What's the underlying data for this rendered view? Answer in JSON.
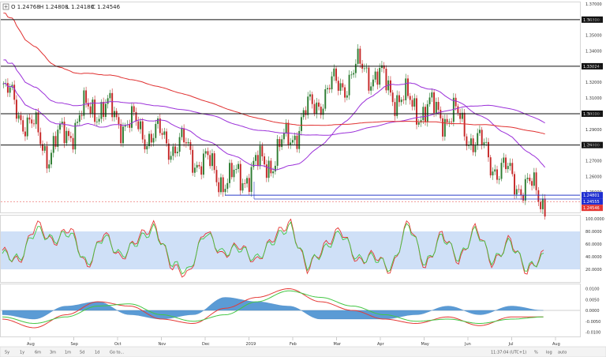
{
  "ohlc_header": {
    "open": "O 1.24768",
    "high": "H 1.24808",
    "low": "L 1.24180",
    "close": "C 1.24546"
  },
  "colors": {
    "candle_up": "#2e7d32",
    "candle_down": "#c62828",
    "hline": "#111111",
    "support": "#2a3cc9",
    "ma_purple": "#9b30d9",
    "ma_red": "#e03030",
    "rsi_band": "#cfe0f7",
    "osc_red": "#e53935",
    "osc_green": "#43c643",
    "macd_hist": "#5b9bd5",
    "price_tag_blue": "#1f2fd1",
    "price_tag_red": "#e53935"
  },
  "toolbar": {
    "left": [
      "5y",
      "1y",
      "6m",
      "3m",
      "1m",
      "5d",
      "1d",
      "Go to..."
    ],
    "time": "11:37:04 (UTC+1)",
    "right": [
      "%",
      "log",
      "auto"
    ]
  },
  "chart_data": [
    {
      "type": "candlestick",
      "instrument_panel": "price",
      "x_tick_labels": [
        "Aug",
        "Sep",
        "Oct",
        "Nov",
        "Dec",
        "2019",
        "Feb",
        "Mar",
        "Apr",
        "May",
        "Jun",
        "Jul",
        "Aug"
      ],
      "y_tick_labels": [
        "1.37000",
        "1.36000",
        "1.35000",
        "1.34000",
        "1.33000",
        "1.32000",
        "1.31000",
        "1.30000",
        "1.29000",
        "1.28000",
        "1.27000",
        "1.26000",
        "1.25000",
        "1.24000"
      ],
      "ylim": [
        1.237,
        1.371
      ],
      "horizontal_lines": [
        1.36,
        1.33024,
        1.3,
        1.28
      ],
      "horizontal_line_labels": [
        "1.36000",
        "1.33024",
        "1.30000",
        "1.28000"
      ],
      "support_lines": [
        1.24801,
        1.24555
      ],
      "price_tags": [
        "1.24801",
        "1.24555",
        "1.24546"
      ],
      "last_close": 1.24546,
      "monthly_closes": [
        {
          "month": "Jul",
          "close": 1.315
        },
        {
          "month": "Aug",
          "close": 1.276
        },
        {
          "month": "Sep",
          "close": 1.306
        },
        {
          "month": "Oct",
          "close": 1.29
        },
        {
          "month": "Nov",
          "close": 1.278
        },
        {
          "month": "Dec",
          "close": 1.256
        },
        {
          "month": "Jan",
          "close": 1.272
        },
        {
          "month": "Feb",
          "close": 1.31
        },
        {
          "month": "Mar",
          "close": 1.33
        },
        {
          "month": "Apr",
          "close": 1.305
        },
        {
          "month": "May",
          "close": 1.298
        },
        {
          "month": "Jun",
          "close": 1.264
        },
        {
          "month": "Jul",
          "close": 1.2454
        }
      ],
      "moving_averages": [
        "purple short MA",
        "purple long MA",
        "red long MA"
      ]
    },
    {
      "type": "line",
      "instrument_panel": "stochastic",
      "y_tick_labels": [
        "100.0000",
        "80.0000",
        "60.0000",
        "40.0000",
        "20.0000"
      ],
      "ylim": [
        0,
        105
      ],
      "band": [
        20,
        80
      ],
      "series": [
        {
          "color": "red",
          "values": [
            50,
            30,
            95,
            60,
            88,
            20,
            80,
            35,
            70,
            90,
            25,
            10,
            85,
            40,
            60,
            30,
            70,
            95,
            20,
            55,
            85,
            30,
            45,
            15,
            100,
            20,
            80,
            30,
            90,
            25,
            70,
            15,
            45
          ]
        },
        {
          "color": "green",
          "values": [
            45,
            35,
            85,
            65,
            80,
            25,
            75,
            40,
            65,
            85,
            30,
            15,
            80,
            45,
            55,
            35,
            65,
            90,
            25,
            50,
            80,
            35,
            40,
            20,
            95,
            25,
            75,
            35,
            85,
            30,
            65,
            20,
            40
          ]
        }
      ]
    },
    {
      "type": "line",
      "instrument_panel": "macd",
      "y_tick_labels": [
        "0.0100",
        "0.0050",
        "0.0000",
        "-0.0050",
        "-0.0100"
      ],
      "ylim": [
        -0.012,
        0.012
      ],
      "series": [
        {
          "color": "red",
          "values": [
            -0.004,
            -0.008,
            -0.002,
            0.004,
            0.002,
            -0.004,
            -0.006,
            0.001,
            0.006,
            0.01,
            0.004,
            0.0,
            -0.004,
            -0.006,
            -0.003,
            -0.007,
            -0.003,
            -0.003
          ]
        },
        {
          "color": "green",
          "values": [
            -0.003,
            -0.006,
            -0.003,
            0.002,
            0.003,
            -0.002,
            -0.005,
            -0.002,
            0.004,
            0.009,
            0.006,
            0.002,
            -0.002,
            -0.005,
            -0.004,
            -0.006,
            -0.004,
            -0.003
          ]
        }
      ]
    }
  ]
}
